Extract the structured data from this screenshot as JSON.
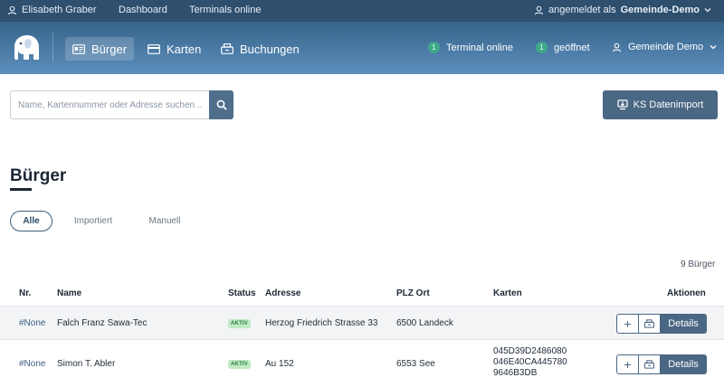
{
  "topbar": {
    "user_name": "Elisabeth Graber",
    "dashboard": "Dashboard",
    "terminals_online": "Terminals online",
    "login_prefix": "angemeldet als",
    "login_org": "Gemeinde-Demo"
  },
  "nav": {
    "items": [
      {
        "label": "Bürger"
      },
      {
        "label": "Karten"
      },
      {
        "label": "Buchungen"
      }
    ],
    "terminal_count": "1",
    "terminal_label": "Terminal online",
    "open_count": "1",
    "open_label": "geöffnet",
    "org_menu": "Gemeinde Demo"
  },
  "search": {
    "placeholder": "Name, Kartennummer oder Adresse suchen ..."
  },
  "import_button": "KS Datenimport",
  "page": {
    "title": "Bürger",
    "tabs": [
      "Alle",
      "Importiert",
      "Manuell"
    ],
    "count": "9 Bürger"
  },
  "table": {
    "headers": [
      "Nr.",
      "Name",
      "Status",
      "Adresse",
      "PLZ Ort",
      "Karten",
      "Aktionen"
    ],
    "rows": [
      {
        "nr": "#None",
        "name": "Falch Franz Sawa-Tec",
        "status": "AKTIV",
        "address": "Herzog Friedrich Strasse 33",
        "plz_ort": "6500 Landeck",
        "cards": [],
        "details": "Details"
      },
      {
        "nr": "#None",
        "name": "Simon T. Abler",
        "status": "AKTIV",
        "address": "Au 152",
        "plz_ort": "6553 See",
        "cards": [
          "045D39D2486080",
          "046E40CA445780",
          "9646B3DB"
        ],
        "details": "Details"
      }
    ]
  },
  "colors": {
    "header_dark": "#2e4f6e",
    "header_gradient_end": "#5d8fbd",
    "accent": "#4a6783",
    "online_dot": "#3fa98a",
    "status_badge_bg": "#bfeac4"
  }
}
